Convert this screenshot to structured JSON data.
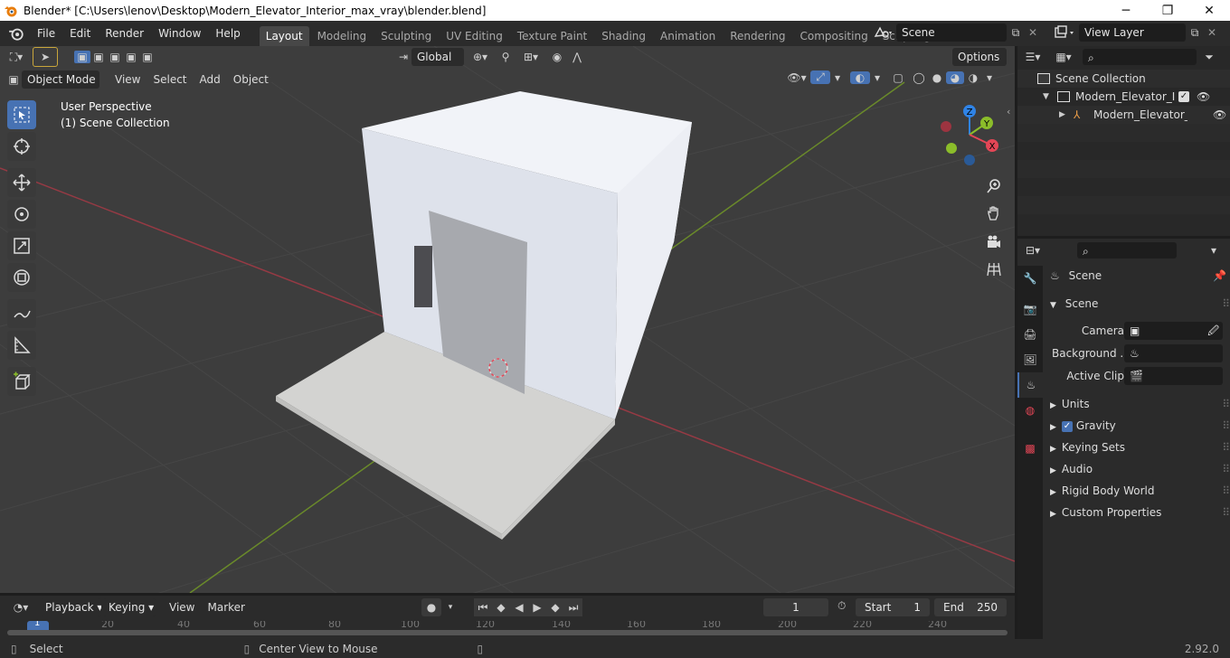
{
  "window": {
    "title": "Blender* [C:\\Users\\lenov\\Desktop\\Modern_Elevator_Interior_max_vray\\blender.blend]",
    "minimize": "─",
    "maximize": "❐",
    "close": "✕"
  },
  "menu": [
    "File",
    "Edit",
    "Render",
    "Window",
    "Help"
  ],
  "workspaces": {
    "tabs": [
      "Layout",
      "Modeling",
      "Sculpting",
      "UV Editing",
      "Texture Paint",
      "Shading",
      "Animation",
      "Rendering",
      "Compositing",
      "Scripting"
    ],
    "active": "Layout",
    "add": "+"
  },
  "scene_field": "Scene",
  "view_layer_field": "View Layer",
  "viewport": {
    "mode": "Object Mode",
    "menus": [
      "View",
      "Select",
      "Add",
      "Object"
    ],
    "transform_orientation": "Global",
    "options": "Options",
    "overlay_line1": "User Perspective",
    "overlay_line2": "(1) Scene Collection",
    "gizmo": {
      "x": "X",
      "y": "Y",
      "z": "Z"
    }
  },
  "outliner": {
    "root": "Scene Collection",
    "items": [
      {
        "label": "Modern_Elevator_Interior"
      },
      {
        "label": "Modern_Elevator_Int"
      }
    ]
  },
  "properties": {
    "context": "Scene",
    "panel": "Scene",
    "fields": [
      {
        "label": "Camera"
      },
      {
        "label": "Background ..."
      },
      {
        "label": "Active Clip"
      }
    ],
    "sections": [
      {
        "label": "Units",
        "checkbox": false
      },
      {
        "label": "Gravity",
        "checkbox": true
      },
      {
        "label": "Keying Sets",
        "checkbox": false
      },
      {
        "label": "Audio",
        "checkbox": false
      },
      {
        "label": "Rigid Body World",
        "checkbox": false
      },
      {
        "label": "Custom Properties",
        "checkbox": false
      }
    ]
  },
  "timeline": {
    "menus": [
      "Playback",
      "Keying",
      "View",
      "Marker"
    ],
    "current_frame": "1",
    "start_label": "Start",
    "start": "1",
    "end_label": "End",
    "end": "250",
    "ruler": [
      "1",
      "20",
      "40",
      "60",
      "80",
      "100",
      "120",
      "140",
      "160",
      "180",
      "200",
      "220",
      "240"
    ]
  },
  "status": {
    "select": "Select",
    "center": "Center View to Mouse",
    "version": "2.92.0"
  },
  "colors": {
    "accent": "#4772b3",
    "active_tab": "#474747",
    "x_axis": "#e44656",
    "y_axis": "#8bbd2a",
    "z_axis": "#2f83e6"
  }
}
